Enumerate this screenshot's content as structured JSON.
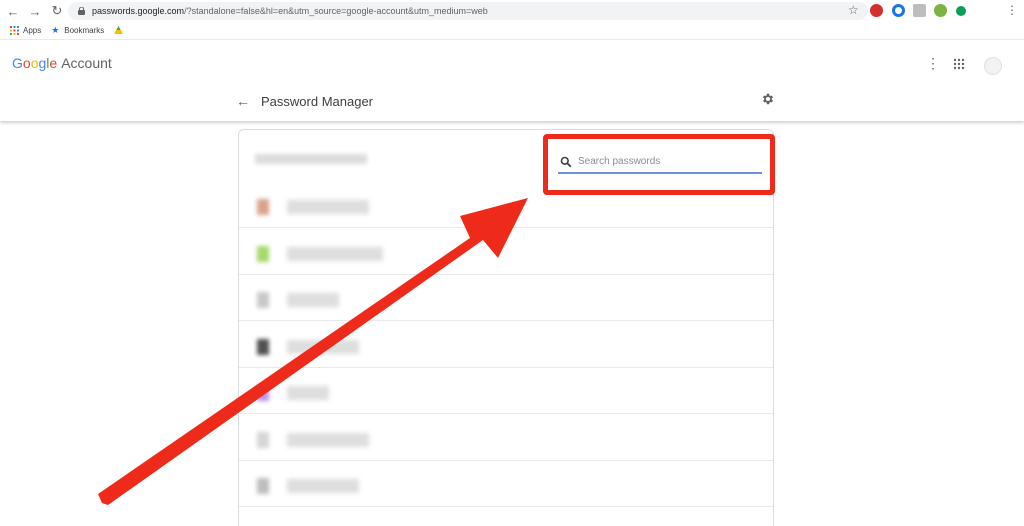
{
  "browser": {
    "url_host": "passwords.google.com",
    "url_path": "/?standalone=false&hl=en&utm_source=google-account&utm_medium=web",
    "bookmarks": [
      {
        "label": "Apps"
      },
      {
        "label": "Bookmarks"
      }
    ]
  },
  "header": {
    "brand_letters": [
      "G",
      "o",
      "o",
      "g",
      "l",
      "e"
    ],
    "brand_suffix": "Account"
  },
  "subheader": {
    "title": "Password Manager"
  },
  "search": {
    "placeholder": "Search passwords",
    "value": ""
  },
  "colors": {
    "highlight": "#ee2b1b",
    "search_underline": "#6d8fd9",
    "google_blue": "#4285f4",
    "google_red": "#ea4335",
    "google_yellow": "#fbbc05",
    "google_green": "#34a853"
  },
  "password_list": {
    "rows": [
      {
        "favicon_color": "#d8a38b"
      },
      {
        "favicon_color": "#a7d86b"
      },
      {
        "favicon_color": "#c8c8c8"
      },
      {
        "favicon_color": "#505050"
      },
      {
        "favicon_color": "#b794e6"
      },
      {
        "favicon_color": "#d5d5d5"
      },
      {
        "favicon_color": "#bdbdbd"
      }
    ]
  }
}
